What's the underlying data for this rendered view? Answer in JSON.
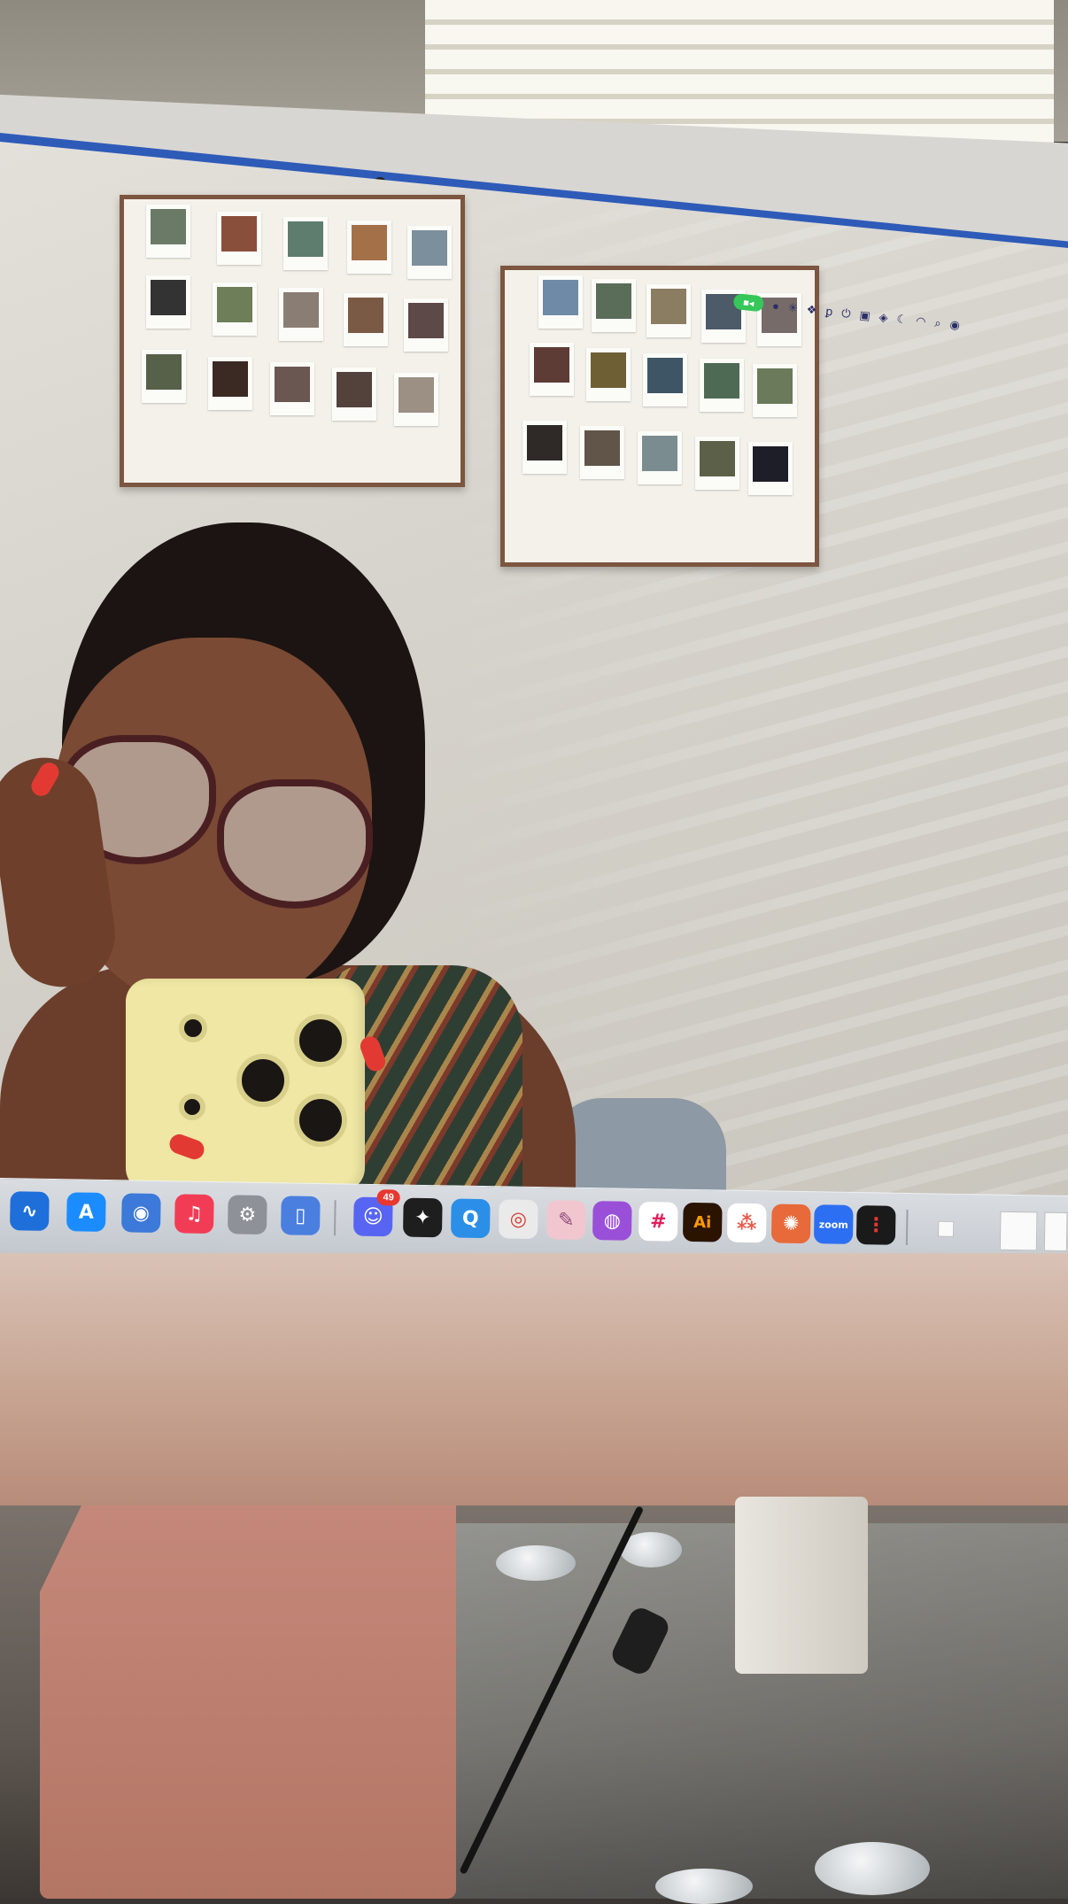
{
  "scene": {
    "description_free": true
  },
  "menubar": {
    "icons": [
      "facetime-icon",
      "control-center-icon",
      "asterisk-icon",
      "dropbox-icon",
      "pocket-icon",
      "power-icon",
      "photos-icon",
      "compass-icon",
      "moon-icon",
      "wifi-icon",
      "search-icon",
      "siri-icon"
    ],
    "facetime_color": "#35c759"
  },
  "dock": {
    "items": [
      {
        "name": "freeform-icon",
        "glyph": "∿",
        "color": "#1e6fd9"
      },
      {
        "name": "app-store-icon",
        "glyph": "A",
        "color": "#1a8cff"
      },
      {
        "name": "screens-icon",
        "glyph": "◉",
        "color": "#3d79d8"
      },
      {
        "name": "music-icon",
        "glyph": "♫",
        "color": "#f23c56"
      },
      {
        "name": "system-settings-icon",
        "glyph": "⚙",
        "color": "#8e9298"
      },
      {
        "name": "simulator-icon",
        "glyph": "▯",
        "color": "#4a7fe0"
      },
      {
        "name": "discord-icon",
        "glyph": "☺",
        "color": "#5865f2",
        "badge": "49"
      },
      {
        "name": "figma-icon",
        "glyph": "✦",
        "color": "#1e1e1e"
      },
      {
        "name": "quicktime-icon",
        "glyph": "Q",
        "color": "#2b8fe8"
      },
      {
        "name": "chrome-icon",
        "glyph": "◎",
        "color": "#eaeaea"
      },
      {
        "name": "notes-app-icon",
        "glyph": "✎",
        "color": "#f1c6cf"
      },
      {
        "name": "podcasts-icon",
        "glyph": "◍",
        "color": "#9a4fd8"
      },
      {
        "name": "slack-icon",
        "glyph": "#",
        "color": "#ffffff"
      },
      {
        "name": "illustrator-icon",
        "glyph": "Ai",
        "color": "#2a1400"
      },
      {
        "name": "dots-app-icon",
        "glyph": "⁂",
        "color": "#ffffff"
      },
      {
        "name": "claude-icon",
        "glyph": "✺",
        "color": "#e8693a"
      },
      {
        "name": "zoom-icon",
        "glyph": "zoom",
        "color": "#2d6ff2"
      },
      {
        "name": "voice-memos-icon",
        "glyph": "⋮",
        "color": "#1a1a1a"
      }
    ],
    "discord_badge": "49"
  }
}
